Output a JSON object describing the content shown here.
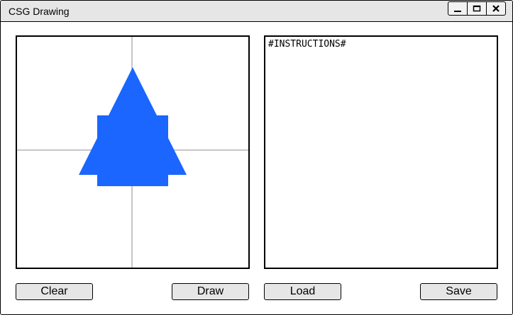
{
  "window": {
    "title": "CSG Drawing",
    "controls": [
      "minimize-icon",
      "maximize-icon",
      "close-icon"
    ]
  },
  "canvas": {
    "shape_color": "#1a66ff",
    "axis_color": "#b3b3b3",
    "shapes": [
      "triangle",
      "rectangle"
    ]
  },
  "instructions": {
    "text": "#INSTRUCTIONS#"
  },
  "buttons": {
    "clear": "Clear",
    "draw": "Draw",
    "load": "Load",
    "save": "Save"
  }
}
